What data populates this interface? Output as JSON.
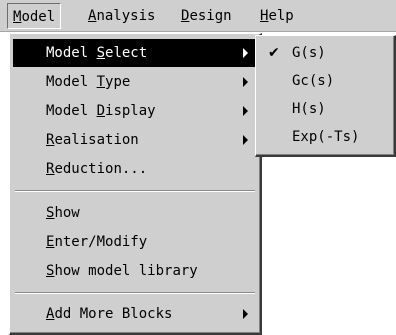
{
  "menubar": {
    "items": [
      {
        "key": "M",
        "rest": "odel"
      },
      {
        "key": "A",
        "rest": "nalysis"
      },
      {
        "key": "D",
        "rest": "esign"
      },
      {
        "key": "H",
        "rest": "elp"
      }
    ]
  },
  "model_menu": {
    "items": [
      {
        "pre": "Model ",
        "key": "S",
        "post": "elect"
      },
      {
        "pre": "Model ",
        "key": "T",
        "post": "ype"
      },
      {
        "pre": "Model ",
        "key": "D",
        "post": "isplay"
      },
      {
        "pre": "",
        "key": "R",
        "post": "ealisation"
      },
      {
        "pre": "",
        "key": "R",
        "post": "eduction..."
      },
      {
        "pre": "",
        "key": "S",
        "post": "how"
      },
      {
        "pre": "",
        "key": "E",
        "post": "nter/Modify"
      },
      {
        "pre": "",
        "key": "S",
        "post": "how model library"
      },
      {
        "pre": "",
        "key": "A",
        "post": "dd More Blocks"
      }
    ]
  },
  "model_select_submenu": {
    "check_glyph": "✔",
    "items": [
      "G(s)",
      "Gc(s)",
      "H(s)",
      "Exp(-Ts)"
    ]
  }
}
